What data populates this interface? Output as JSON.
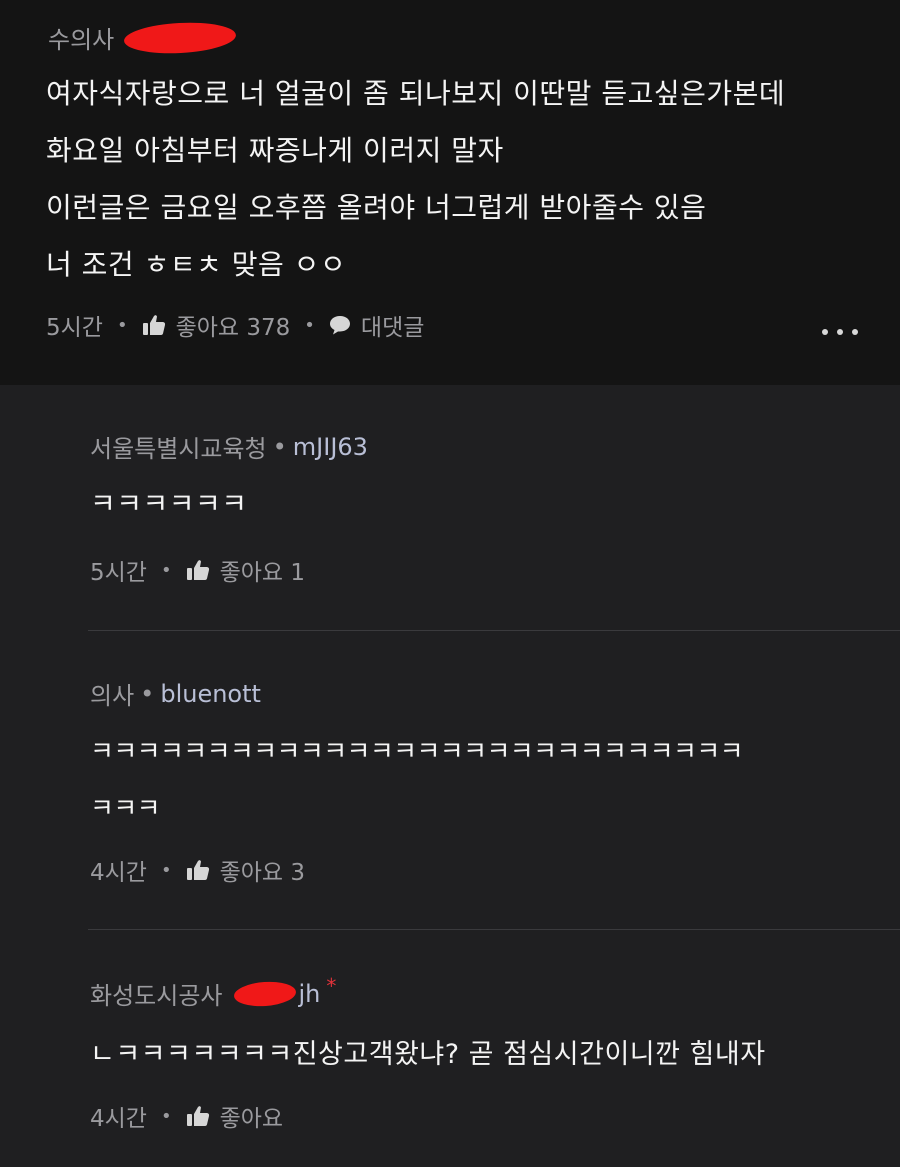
{
  "top_comment": {
    "author": "수의사",
    "lines": [
      "여자식자랑으로 너 얼굴이 좀 되나보지 이딴말 듣고싶은가본데",
      "화요일 아침부터 짜증나게 이러지 말자",
      "이런글은 금요일 오후쯤 올려야 너그럽게 받아줄수 있음",
      "너 조건 ㅎㅌㅊ 맞음 ㅇㅇ"
    ],
    "time": "5시간",
    "like_label": "좋아요 378",
    "reply_label": "대댓글"
  },
  "replies": [
    {
      "author": "서울특별시교육청",
      "nick": "mJIJ63",
      "lines": [
        "ㅋㅋㅋㅋㅋㅋ"
      ],
      "time": "5시간",
      "like_label": "좋아요 1"
    },
    {
      "author": "의사",
      "nick": "bluenott",
      "lines": [
        "ㅋㅋㅋㅋㅋㅋㅋㅋㅋㅋㅋㅋㅋㅋㅋㅋㅋㅋㅋㅋㅋㅋㅋㅋㅋㅋㅋㅋ",
        "ㅋㅋㅋ"
      ],
      "time": "4시간",
      "like_label": "좋아요 3"
    },
    {
      "author": "화성도시공사",
      "nick": "jh",
      "lines": [
        "ㄴㅋㅋㅋㅋㅋㅋㅋ진상고객왔냐? 곧 점심시간이니깐 힘내자"
      ],
      "time": "4시간",
      "like_label": "좋아요"
    }
  ],
  "colors": {
    "top_bg": "#141414",
    "reply_bg": "#1f1f21",
    "redaction": "#f01818",
    "nick": "#b9bfd6",
    "star": "#e0323a"
  },
  "icons": {
    "like": "thumbs-up-icon",
    "reply": "speech-bubble-icon",
    "more": "more-dots-icon"
  }
}
